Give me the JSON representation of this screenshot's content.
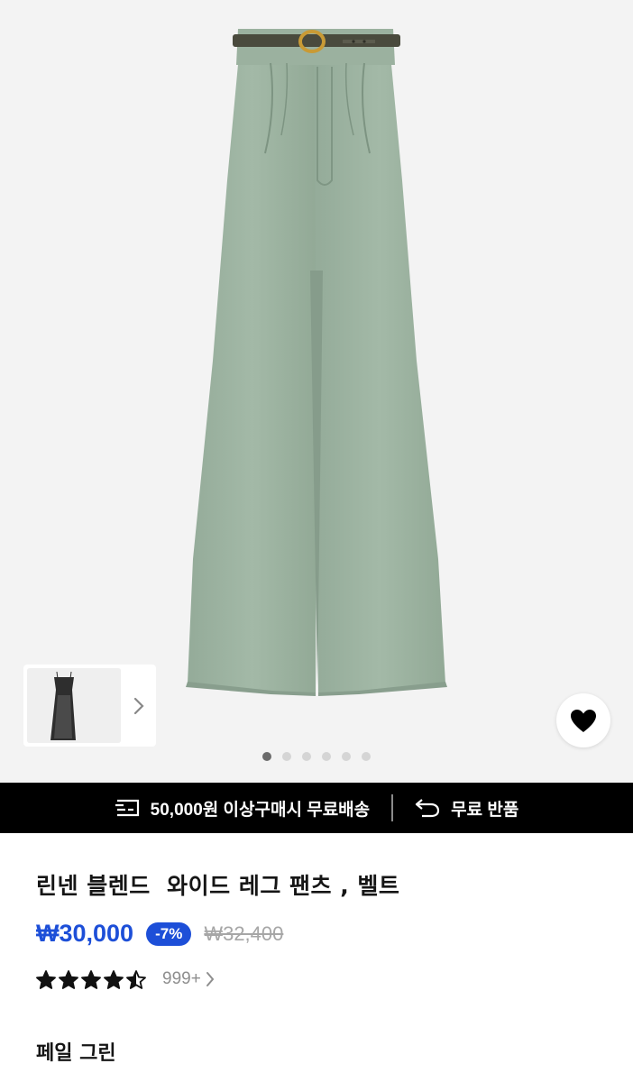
{
  "gallery": {
    "product_image_alt": "sage green wide leg pants with belt",
    "page_count": 6,
    "active_index": 0,
    "wish_icon": "heart-icon",
    "thumb_arrow_icon": "chevron-right-icon"
  },
  "promo": {
    "shipping_icon": "fast-delivery-icon",
    "shipping_text": "50,000원 이상구매시 무료배송",
    "return_icon": "return-arrow-icon",
    "return_text": "무료 반품"
  },
  "product": {
    "title": "린넨 블렌드  와이드 레그 팬츠 , 벨트",
    "price": "₩30,000",
    "discount": "-7%",
    "original_price": "₩32,400",
    "rating": 4.5,
    "review_count": "999+",
    "color_name": "페일 그린"
  },
  "colors": {
    "accent": "#1d4fd8",
    "pants": "#9fb5a3",
    "promo_bg": "#000000"
  }
}
